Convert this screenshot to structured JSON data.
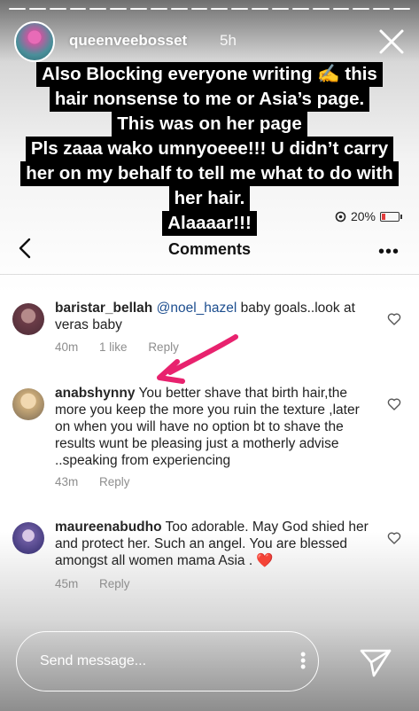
{
  "story": {
    "username": "queenveebosset",
    "time_ago": "5h",
    "caption_lines": [
      "Also Blocking everyone writing ✍️ this",
      "hair nonsense to me or Asia’s page.",
      "This was on her page",
      "Pls zaaa wako umnyoeee!!! U didn’t carry",
      "her on my behalf to tell me what to do with",
      "her hair.",
      "Alaaaar!!!"
    ]
  },
  "status_bar": {
    "battery_text": "20%",
    "battery_level": 0.2
  },
  "comments_header": {
    "title": "Comments"
  },
  "comments": [
    {
      "username": "baristar_bellah",
      "mention": "@noel_hazel",
      "text": " baby goals..look at veras baby",
      "time": "40m",
      "likes": "1 like",
      "reply_label": "Reply"
    },
    {
      "username": "anabshynny",
      "mention": "",
      "text": " You better shave that birth hair,the more you keep the more you ruin the texture ,later on when you will have no option bt to  shave the results wunt be pleasing just a motherly advise ..speaking from experiencing",
      "time": "43m",
      "reply_label": "Reply"
    },
    {
      "username": "maureenabudho",
      "mention": "",
      "text": " Too adorable. May God shied her and protect her. Such an angel. You are blessed amongst all women mama Asia . ❤️",
      "time": "45m",
      "reply_label": "Reply"
    }
  ],
  "send_bar": {
    "placeholder": "Send message..."
  },
  "colors": {
    "annotation_arrow": "#e8226e",
    "mention": "#1d4e8f",
    "battery_low": "#e23d3d"
  }
}
